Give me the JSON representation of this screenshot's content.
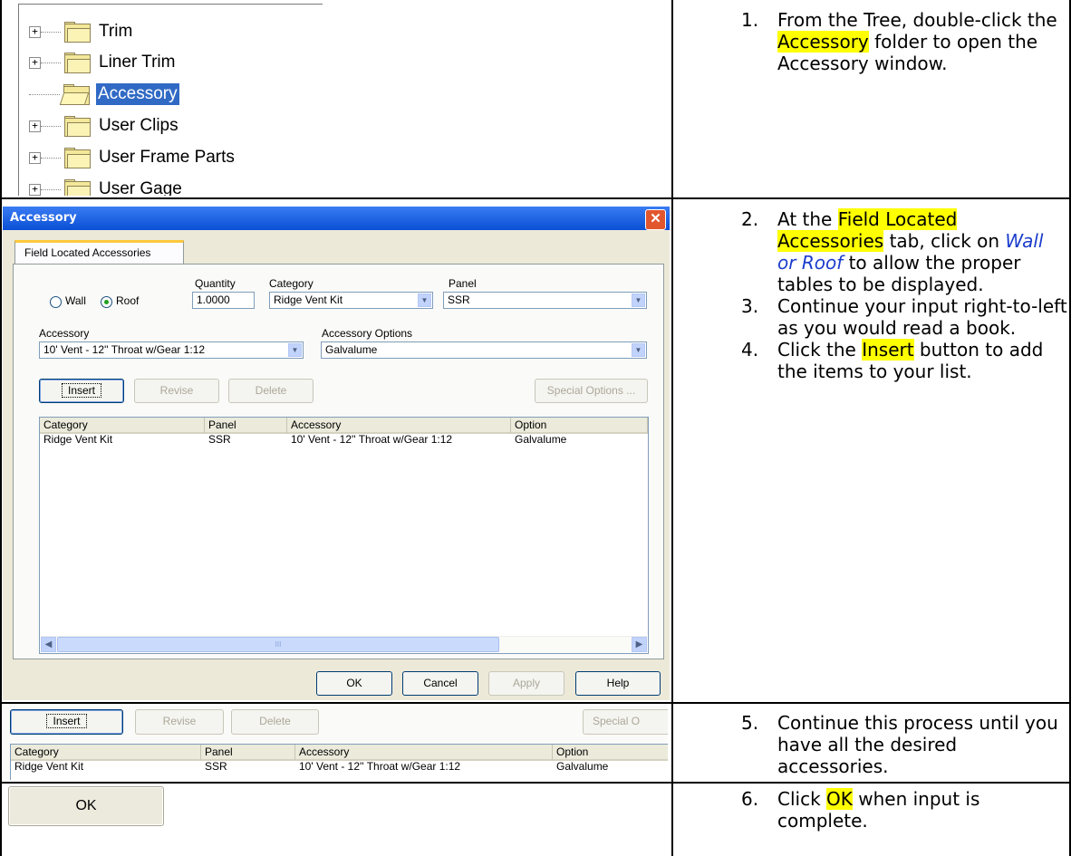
{
  "tree": {
    "items": [
      {
        "label": "Trim",
        "expander": "+"
      },
      {
        "label": "Liner Trim",
        "expander": "+"
      },
      {
        "label": "Accessory",
        "expander": ""
      },
      {
        "label": "User Clips",
        "expander": "+"
      },
      {
        "label": "User Frame Parts",
        "expander": "+"
      },
      {
        "label": "User Gage",
        "expander": "+"
      }
    ]
  },
  "steps": {
    "s1": {
      "num": "1.",
      "pre": "From the Tree, double-click the ",
      "hl": "Accessory",
      "post": " folder to open the Accessory window."
    },
    "s2": {
      "num": "2.",
      "pre": "At the ",
      "hl": "Field Located Accessories",
      "mid": " tab, click on ",
      "it": "Wall or Roof",
      "post": " to allow the proper tables to be displayed."
    },
    "s3": {
      "num": "3.",
      "text": "Continue your input right-to-left as you would read a book."
    },
    "s4": {
      "num": "4.",
      "pre": "Click the ",
      "hl": "Insert",
      "post": " button to add the items to your list."
    },
    "s5": {
      "num": "5.",
      "text": "Continue this process until you have all the desired accessories."
    },
    "s6": {
      "num": "6.",
      "pre": "Click ",
      "hl": "OK",
      "post": " when input is complete."
    }
  },
  "dialog": {
    "title": "Accessory",
    "close": "✕",
    "tab": "Field Located Accessories",
    "wall": "Wall",
    "roof": "Roof",
    "quantity_label": "Quantity",
    "quantity": "1.0000",
    "category_label": "Category",
    "category": "Ridge Vent Kit",
    "panel_label": "Panel",
    "panel": "SSR",
    "accessory_label": "Accessory",
    "accessory": "10' Vent - 12'' Throat w/Gear 1:12",
    "options_label": "Accessory Options",
    "options": "Galvalume",
    "insert": "Insert",
    "revise": "Revise",
    "delete": "Delete",
    "special": "Special Options ...",
    "columns": [
      "Category",
      "Panel",
      "Accessory",
      "Option"
    ],
    "row": [
      "Ridge Vent Kit",
      "SSR",
      "10' Vent - 12'' Throat w/Gear 1:12",
      "Galvalume"
    ],
    "ok": "OK",
    "cancel": "Cancel",
    "apply": "Apply",
    "help": "Help",
    "scroll_grip": "III"
  },
  "snippet": {
    "insert": "Insert",
    "revise": "Revise",
    "delete": "Delete",
    "special": "Special O"
  },
  "ok_big": "OK"
}
